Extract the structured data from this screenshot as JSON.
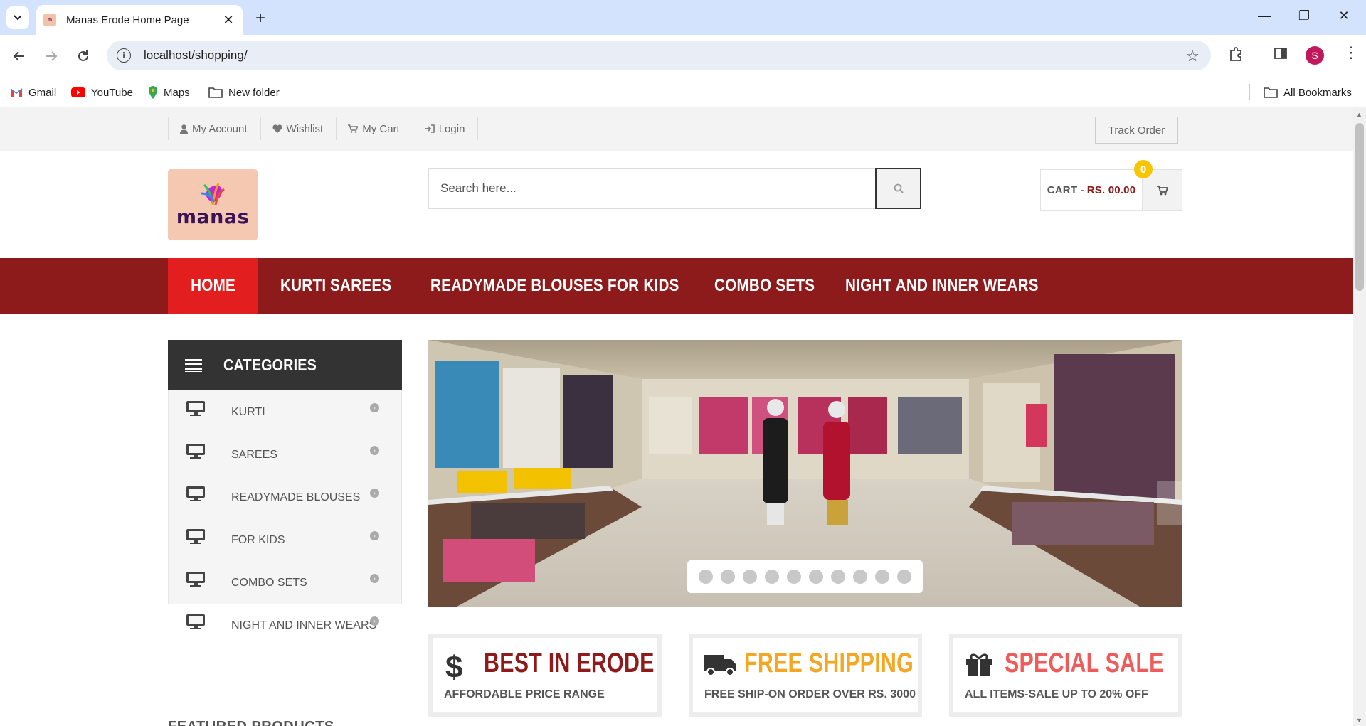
{
  "browser": {
    "tab_title": "Manas Erode Home Page",
    "url": "localhost/shopping/",
    "profile_initial": "S",
    "bookmarks": [
      {
        "label": "Gmail",
        "icon": "gmail-icon"
      },
      {
        "label": "YouTube",
        "icon": "youtube-icon"
      },
      {
        "label": "Maps",
        "icon": "maps-icon"
      },
      {
        "label": "New folder",
        "icon": "folder-icon"
      }
    ],
    "all_bookmarks": "All Bookmarks"
  },
  "topbar": {
    "links": [
      {
        "label": "My Account",
        "icon": "user-icon"
      },
      {
        "label": "Wishlist",
        "icon": "heart-icon"
      },
      {
        "label": "My Cart",
        "icon": "cart-icon"
      },
      {
        "label": "Login",
        "icon": "sign-in-icon"
      }
    ],
    "track_order": "Track Order"
  },
  "header": {
    "logo_text": "manas",
    "search_placeholder": "Search here...",
    "cart_label": "CART -",
    "cart_price": "RS. 00.00",
    "cart_count": "0"
  },
  "nav": {
    "items": [
      "HOME",
      "KURTI",
      "SAREES",
      "READYMADE BLOUSES",
      "FOR KIDS",
      "COMBO SETS",
      "NIGHT AND INNER WEARS"
    ],
    "active": "HOME"
  },
  "categories": {
    "title": "CATEGORIES",
    "items": [
      "KURTI",
      "SAREES",
      "READYMADE BLOUSES",
      "FOR KIDS",
      "COMBO SETS",
      "NIGHT AND INNER WEARS"
    ]
  },
  "slider": {
    "dot_count": 10,
    "active_dot": 0
  },
  "features": [
    {
      "icon": "dollar-icon",
      "title": "BEST IN ERODE",
      "subtitle": "AFFORDABLE PRICE RANGE",
      "color": "#8e1b1b"
    },
    {
      "icon": "truck-icon",
      "title": "FREE SHIPPING",
      "subtitle": "FREE SHIP-ON ORDER OVER RS. 3000",
      "color": "#f5a623"
    },
    {
      "icon": "gift-icon",
      "title": "SPECIAL SALE",
      "subtitle": "ALL ITEMS-SALE UP TO 20% OFF",
      "color": "#ef5b5b"
    }
  ],
  "featured_products_title": "FEATURED PRODUCTS",
  "colors": {
    "nav_bg": "#8e1b1b",
    "nav_active": "#e31e1e",
    "cart_badge": "#f7c600"
  }
}
